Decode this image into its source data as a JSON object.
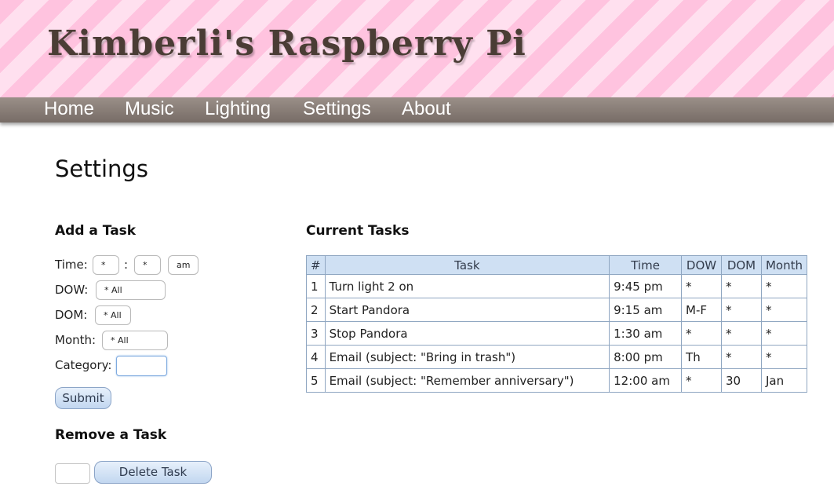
{
  "site": {
    "title": "Kimberli's Raspberry Pi"
  },
  "nav": {
    "items": [
      "Home",
      "Music",
      "Lighting",
      "Settings",
      "About"
    ]
  },
  "page": {
    "title": "Settings"
  },
  "add_task": {
    "heading": "Add a Task",
    "time_label": "Time:",
    "hour_value": "*",
    "time_separator": ":",
    "minute_value": "*",
    "ampm_value": "am",
    "dow_label": "DOW:",
    "dow_value": "* All",
    "dom_label": "DOM:",
    "dom_value": "* All",
    "month_label": "Month:",
    "month_value": "* All",
    "category_label": "Category:",
    "category_value": "",
    "submit_label": "Submit"
  },
  "remove_task": {
    "heading": "Remove a Task",
    "task_number_value": "",
    "delete_label": "Delete Task"
  },
  "current_tasks": {
    "heading": "Current Tasks",
    "columns": [
      "#",
      "Task",
      "Time",
      "DOW",
      "DOM",
      "Month"
    ],
    "rows": [
      [
        "1",
        "Turn light 2 on",
        "9:45 pm",
        "*",
        "*",
        "*"
      ],
      [
        "2",
        "Start Pandora",
        "9:15 am",
        "M-F",
        "*",
        "*"
      ],
      [
        "3",
        "Stop Pandora",
        "1:30 am",
        "*",
        "*",
        "*"
      ],
      [
        "4",
        "Email (subject: \"Bring in trash\")",
        "8:00 pm",
        "Th",
        "*",
        "*"
      ],
      [
        "5",
        "Email (subject: \"Remember anniversary\")",
        "12:00 am",
        "*",
        "30",
        "Jan"
      ]
    ]
  },
  "colors": {
    "banner_stripe_dark": "#ffc3df",
    "banner_stripe_light": "#ffe0ef",
    "navbar": "#8a7f78",
    "title_text": "#4a3d35",
    "table_header": "#cfe0f3",
    "table_border": "#8fa6c1"
  }
}
